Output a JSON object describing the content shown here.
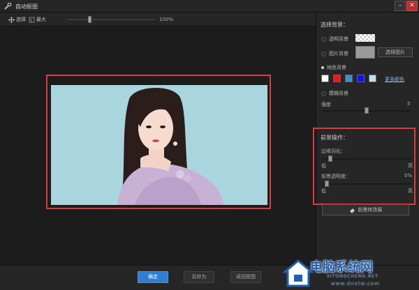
{
  "window": {
    "title": "自动抠图",
    "minimize": "–",
    "close": "✕"
  },
  "toolbar": {
    "select_label": "选择",
    "max_label": "最大",
    "zoom_value_text": "100%",
    "zoom_level": 0.25
  },
  "panel": {
    "background_title": "选择背景：",
    "transparent_label": "透明背景",
    "image_label": "图片背景",
    "choose_image_button": "选择图片",
    "solid_label": "纯色背景",
    "colors": [
      "#ffffff",
      "#e61a1a",
      "#3b8fd4",
      "#1414e0",
      "#bfe0ea"
    ],
    "more_colors_link": "更多颜色",
    "blur_label": "模糊背景",
    "intensity_label": "强度",
    "intensity_value": "5",
    "intensity_level": 0.5,
    "foreground_title": "前景操作：",
    "feather_label": "边缘羽化：",
    "feather_low": "低",
    "feather_high": "高",
    "feather_level": 0.07,
    "opacity_label": "前景透明度：",
    "opacity_value": "0%",
    "opacity_low": "低",
    "opacity_high": "高",
    "opacity_level": 0.03,
    "fg_fix_button": "前景修改报"
  },
  "bottom": {
    "confirm": "确定",
    "save_as": "另存为",
    "return_crop": "返回抠图"
  },
  "watermark": {
    "title": "电脑系统网",
    "subtitle": "XITONGCHENG.NET",
    "url": "www.dnxtw.com"
  }
}
